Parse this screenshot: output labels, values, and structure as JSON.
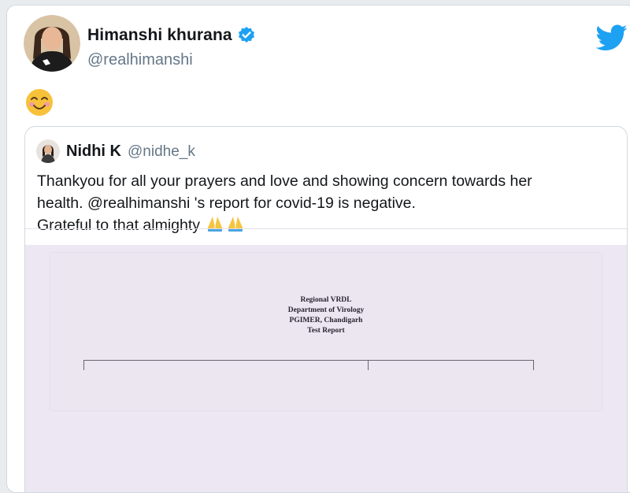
{
  "tweet": {
    "author_name": "Himanshi khurana",
    "author_handle": "@realhimanshi",
    "verified": true,
    "text_emoji": "smiling-face-with-smiling-eyes"
  },
  "quoted_tweet": {
    "author_name": "Nidhi K",
    "author_handle": "@nidhe_k",
    "text_line_1": "Thankyou for all your prayers and love and showing concern towards her",
    "text_line_2": "health. @realhimanshi 's report for covid-19 is negative.",
    "text_line_3": "Grateful to that almighty",
    "trailing_emoji": "folded-hands x2"
  },
  "report": {
    "line_1": "Regional VRDL",
    "line_2": "Department of Virology",
    "line_3": "PGIMER, Chandigarh",
    "line_4": "Test Report"
  },
  "colors": {
    "twitter_blue": "#1da1f2",
    "text_primary": "#14171a",
    "text_secondary": "#657786",
    "border": "#cfd9de",
    "media_background": "#ece7f2"
  }
}
